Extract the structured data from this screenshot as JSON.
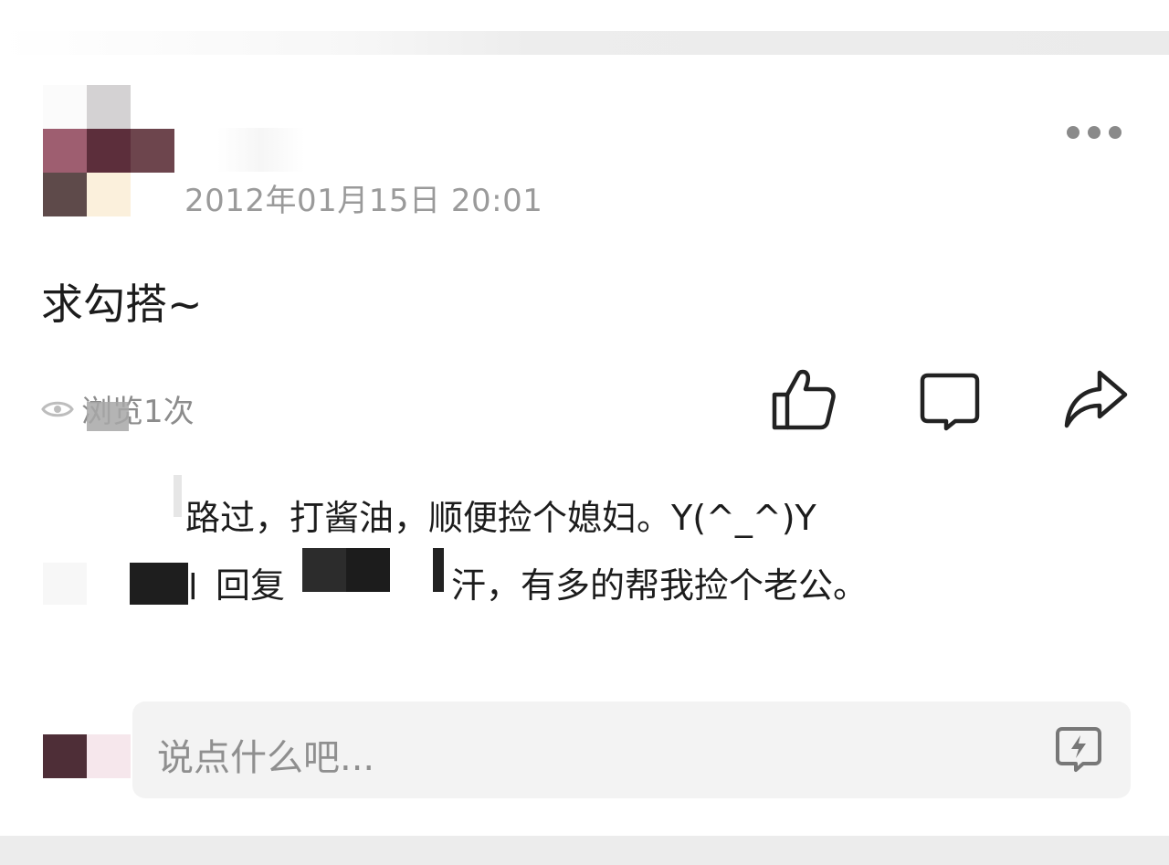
{
  "post": {
    "timestamp": "2012年01月15日 20:01",
    "text": "求勾搭~",
    "views": "浏览1次"
  },
  "comments": [
    {
      "text": "路过，打酱油，顺便捡个媳妇。Y(^_^)Y"
    },
    {
      "name_fragment": "l",
      "reply_label": "回复",
      "text": "汗，有多的帮我捡个老公。"
    }
  ],
  "composer": {
    "placeholder": "说点什么吧..."
  },
  "icons": {
    "more": "more-icon",
    "eye": "eye-icon",
    "like": "thumbs-up-icon",
    "comment": "comment-icon",
    "share": "share-icon",
    "quick": "quick-reply-icon"
  }
}
